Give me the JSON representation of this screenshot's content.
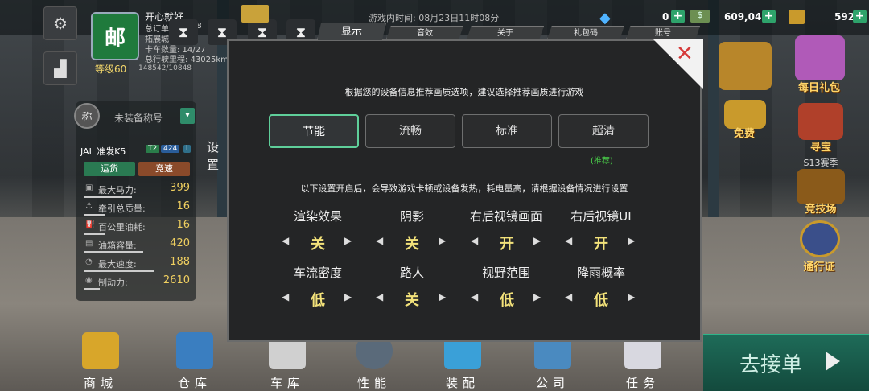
{
  "header": {
    "player_name": "开心就好",
    "stats": [
      "总订单:",
      "拓展城市:",
      "卡车数量: 14/27",
      "总行驶里程: 43025km"
    ],
    "stat_partials": [
      "68",
      "2"
    ],
    "level": "等级60",
    "xp": "148542/10848",
    "game_time": "游戏内时间: 08月23日11时08分",
    "currency": {
      "gems": "0",
      "cash": "609,046",
      "gold": "592"
    }
  },
  "left_panel": {
    "badge": "称",
    "title": "未装备称号",
    "truck_name": "JAL 准发K5",
    "tags": [
      "T2",
      "424",
      "i"
    ],
    "modes": [
      "运货",
      "竞速"
    ],
    "stats": [
      {
        "label": "最大马力:",
        "value": "399",
        "fill": 0.45
      },
      {
        "label": "牵引总质量:",
        "value": "16",
        "fill": 0.2
      },
      {
        "label": "百公里油耗:",
        "value": "16",
        "fill": 0.2
      },
      {
        "label": "油箱容量:",
        "value": "420",
        "fill": 0.55
      },
      {
        "label": "最大速度:",
        "value": "188",
        "fill": 0.65
      },
      {
        "label": "制动力:",
        "value": "2610",
        "fill": 0.15
      }
    ]
  },
  "dialog": {
    "side_title": "设置",
    "tabs": [
      "显示",
      "音效",
      "关于",
      "礼包码",
      "账号"
    ],
    "hint_top": "根据您的设备信息推荐画质选项，建议选择推荐画质进行游戏",
    "quality": [
      "节能",
      "流畅",
      "标准",
      "超清"
    ],
    "recommend": "(推荐)",
    "hint_mid": "以下设置开启后，会导致游戏卡顿或设备发热，耗电量高，请根据设备情况进行设置",
    "settings": [
      {
        "label": "渲染效果",
        "value": "关"
      },
      {
        "label": "阴影",
        "value": "关"
      },
      {
        "label": "右后视镜画面",
        "value": "开"
      },
      {
        "label": "右后视镜UI",
        "value": "开"
      },
      {
        "label": "车流密度",
        "value": "低"
      },
      {
        "label": "路人",
        "value": "关"
      },
      {
        "label": "视野范围",
        "value": "低"
      },
      {
        "label": "降雨概率",
        "value": "低"
      }
    ]
  },
  "right": {
    "daily": "每日礼包",
    "free": "免费",
    "treasure": "寻宝",
    "season": "S13赛季",
    "arena": "竞技场",
    "pass": "通行证",
    "go": "去接单"
  },
  "nav": [
    "商城",
    "仓库",
    "车库",
    "性能",
    "装配",
    "公司",
    "任务"
  ]
}
